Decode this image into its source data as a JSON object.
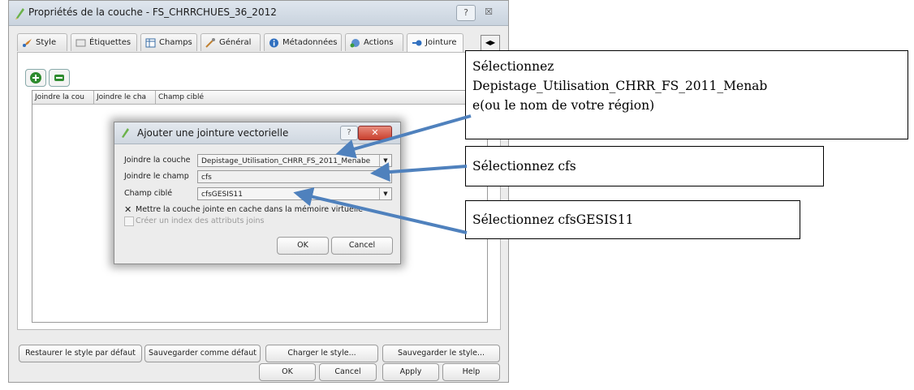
{
  "window": {
    "title": "Propriétés de la couche - FS_CHRRCHUES_36_2012",
    "help_label": "?",
    "close_label": "☒"
  },
  "tabs": [
    {
      "label": "Style",
      "icon": "brush-icon"
    },
    {
      "label": "Étiquettes",
      "icon": "labels-icon"
    },
    {
      "label": "Champs",
      "icon": "table-icon"
    },
    {
      "label": "Général",
      "icon": "tools-icon"
    },
    {
      "label": "Métadonnées",
      "icon": "info-icon"
    },
    {
      "label": "Actions",
      "icon": "actions-icon"
    },
    {
      "label": "Jointure",
      "icon": "join-icon"
    }
  ],
  "joins_table": {
    "columns": [
      "Joindre la cou",
      "Joindre le cha",
      "Champ ciblé"
    ]
  },
  "bottom_buttons": {
    "restore": "Restaurer le style par défaut",
    "save_default": "Sauvegarder comme défaut",
    "load_style": "Charger le style...",
    "save_style": "Sauvegarder le style...",
    "ok": "OK",
    "cancel": "Cancel",
    "apply": "Apply",
    "help": "Help"
  },
  "dialog": {
    "title": "Ajouter une jointure vectorielle",
    "join_layer_label": "Joindre la couche",
    "join_layer_value": "Depistage_Utilisation_CHRR_FS_2011_Menabe",
    "join_field_label": "Joindre le champ",
    "join_field_value": "cfs",
    "target_field_label": "Champ ciblé",
    "target_field_value": "cfsGESIS11",
    "cache_label": "Mettre la couche jointe en cache dans la mémoire virtuelle",
    "index_label": "Créer un index des attributs joins",
    "ok": "OK",
    "cancel": "Cancel"
  },
  "callouts": {
    "layer_line1": "Sélectionnez",
    "layer_line2": "Depistage_Utilisation_CHRR_FS_2011_Menab",
    "layer_line3": "e(ou le nom de votre région)",
    "field": "Sélectionnez cfs",
    "target": "Sélectionnez cfsGESIS11"
  },
  "colors": {
    "arrow": "#4f81bd",
    "add_icon": "#2e8b2e",
    "close_button": "#c9402e"
  }
}
